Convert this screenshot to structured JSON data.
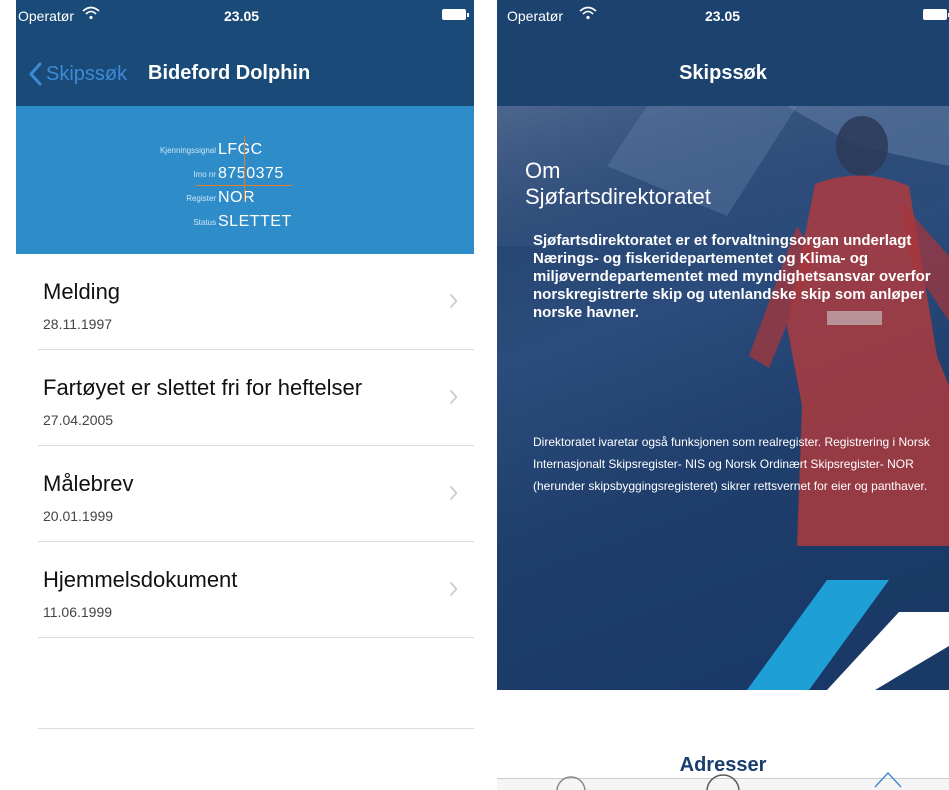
{
  "left": {
    "status": {
      "carrier": "Operatør",
      "time": "23.05"
    },
    "nav": {
      "back_label": "Skipssøk",
      "title": "Bideford Dolphin"
    },
    "ship_info": [
      {
        "label": "Kjenningssignal",
        "value": "LFGC"
      },
      {
        "label": "Imo nr",
        "value": "8750375"
      },
      {
        "label": "Register",
        "value": "NOR"
      },
      {
        "label": "Status",
        "value": "SLETTET"
      }
    ],
    "documents": [
      {
        "title": "Melding",
        "date": "28.11.1997"
      },
      {
        "title": "Fartøyet er slettet fri for heftelser",
        "date": "27.04.2005"
      },
      {
        "title": "Målebrev",
        "date": "20.01.1999"
      },
      {
        "title": "Hjemmelsdokument",
        "date": "11.06.1999"
      }
    ]
  },
  "right": {
    "status": {
      "carrier": "Operatør",
      "time": "23.05"
    },
    "nav": {
      "title": "Skipssøk"
    },
    "about": {
      "title_line1": "Om",
      "title_line2": "Sjøfartsdirektoratet",
      "lead": "Sjøfartsdirektoratet er et forvaltningsorgan underlagt Nærings- og fiskeridepartementet og Klima- og miljøverndepartementet med myndighetsansvar overfor norskregistrerte skip og utenlandske skip som anløper norske havner.",
      "body": "Direktoratet ivaretar også funksjonen som realregister. Registrering i Norsk Internasjonalt Skipsregister- NIS og Norsk Ordinært Skipsregister- NOR (herunder skipsbyggingsregisteret) sikrer rettsvernet for eier og panthaver."
    },
    "addresses_title": "Adresser"
  },
  "colors": {
    "nav_dark": "#1a4a78",
    "info_blue": "#2e8cc8",
    "accent_blue": "#3d8bd6",
    "stripe_cyan": "#1e9fd6",
    "crosshair": "#e27d2a"
  }
}
